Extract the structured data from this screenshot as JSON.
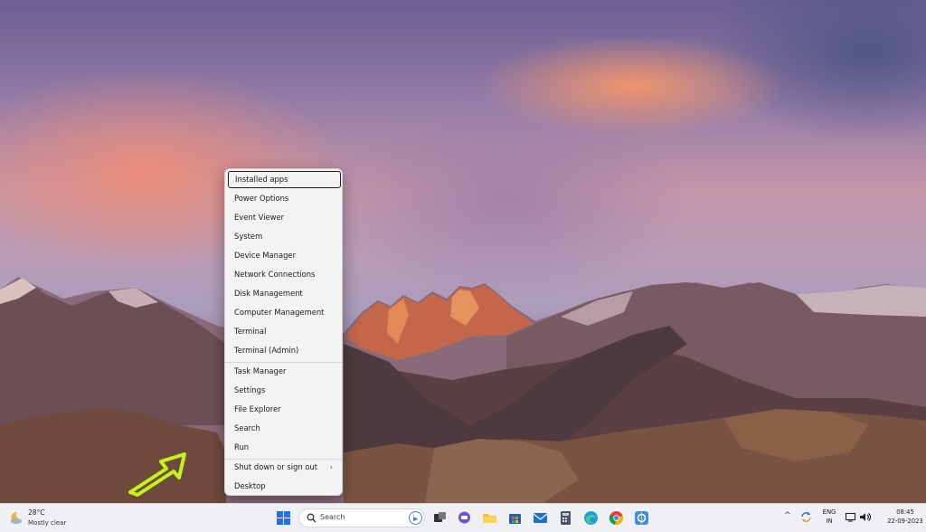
{
  "context_menu": {
    "items": [
      {
        "label": "Installed apps"
      },
      {
        "label": "Power Options"
      },
      {
        "label": "Event Viewer"
      },
      {
        "label": "System"
      },
      {
        "label": "Device Manager"
      },
      {
        "label": "Network Connections"
      },
      {
        "label": "Disk Management"
      },
      {
        "label": "Computer Management"
      },
      {
        "label": "Terminal"
      },
      {
        "label": "Terminal (Admin)"
      },
      {
        "label": "Task Manager"
      },
      {
        "label": "Settings"
      },
      {
        "label": "File Explorer"
      },
      {
        "label": "Search"
      },
      {
        "label": "Run"
      },
      {
        "label": "Shut down or sign out"
      },
      {
        "label": "Desktop"
      }
    ],
    "submenu_glyph": "›"
  },
  "taskbar": {
    "weather": {
      "temp": "28°C",
      "desc": "Mostly clear",
      "icon": "moon-cloud-icon"
    },
    "search": {
      "label": "Search"
    },
    "pinned_icons": [
      "windows-start-icon",
      "search-icon",
      "bing-icon",
      "task-view-icon",
      "chat-icon",
      "file-explorer-icon",
      "microsoft-store-icon",
      "mail-icon",
      "calculator-icon",
      "edge-icon",
      "chrome-icon",
      "snipping-tool-icon"
    ],
    "tray": {
      "chevron": "^",
      "language": {
        "line1": "ENG",
        "line2": "IN"
      },
      "clock": {
        "time": "08:45",
        "date": "22-09-2023"
      }
    }
  },
  "colors": {
    "arrow": "#c6f21c",
    "menu_bg": "#f3f3f3",
    "taskbar_bg": "#eef0f3",
    "start_blue": "#1a73e8"
  }
}
